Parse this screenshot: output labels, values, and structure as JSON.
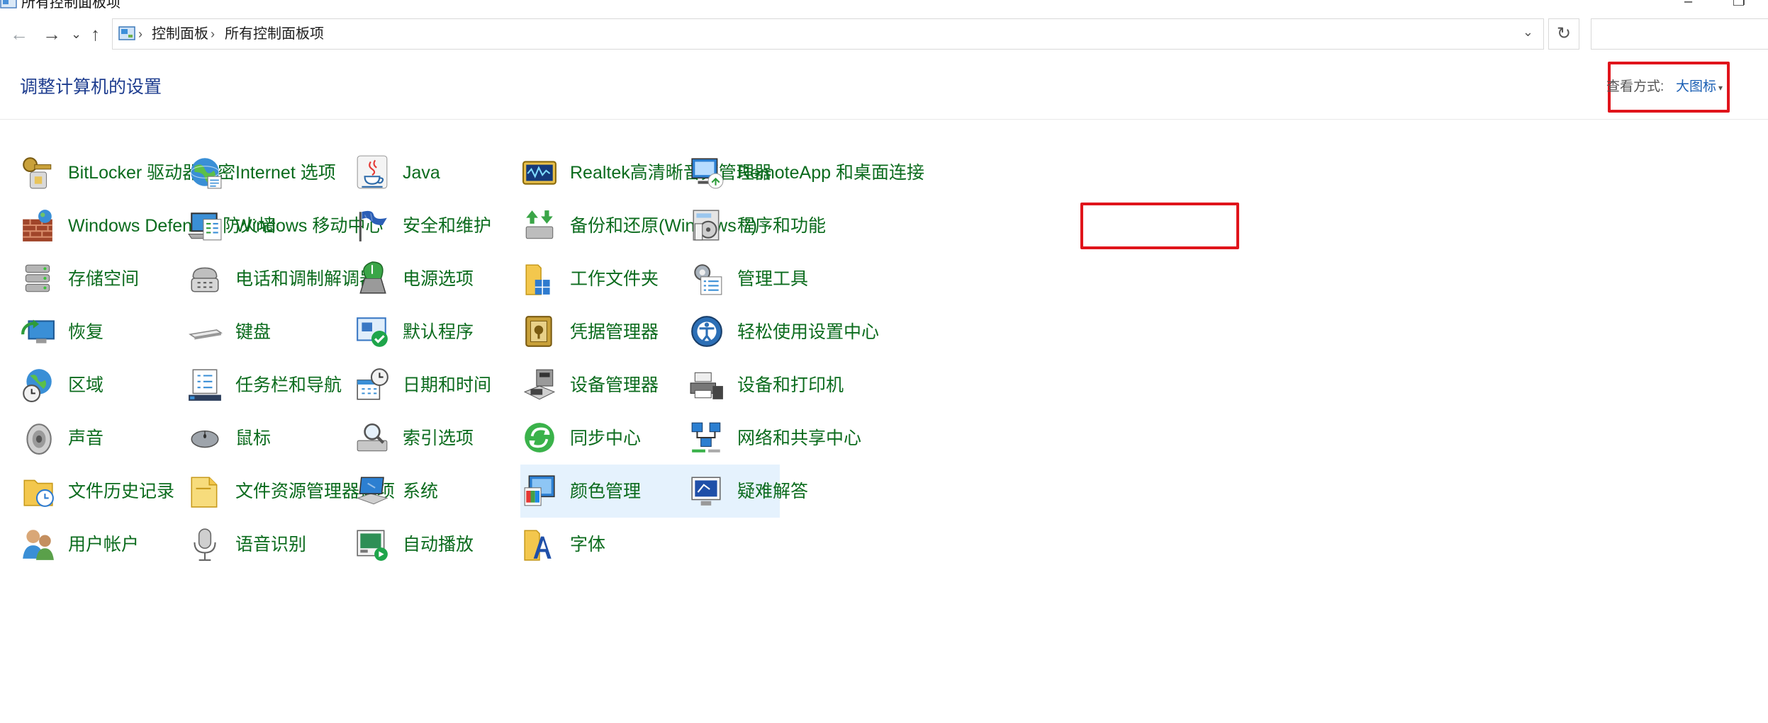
{
  "window": {
    "title": "所有控制面板项",
    "minimize_glyph": "–",
    "restore_glyph": "❐"
  },
  "nav": {
    "back_glyph": "←",
    "forward_glyph": "→",
    "recent_glyph": "⌄",
    "up_glyph": "↑",
    "breadcrumb": [
      "控制面板",
      "所有控制面板项"
    ],
    "breadcrumb_sep": "›",
    "dropdown_glyph": "⌄",
    "refresh_glyph": "↻",
    "search_placeholder": ""
  },
  "header": {
    "title": "调整计算机的设置",
    "view_label": "查看方式:",
    "view_value": "大图标",
    "view_caret": "▾"
  },
  "colors": {
    "item_text": "#0b6b1d",
    "title_text": "#1e3d8f",
    "highlight": "#e0141b",
    "selected_bg": "#e5f2fd"
  },
  "items": [
    [
      "BitLocker 驱动器加密",
      "Windows Defender 防火墙",
      "存储空间",
      "恢复",
      "区域",
      "声音",
      "文件历史记录",
      "用户帐户"
    ],
    [
      "Internet 选项",
      "Windows 移动中心",
      "电话和调制解调器",
      "键盘",
      "任务栏和导航",
      "鼠标",
      "文件资源管理器选项",
      "语音识别"
    ],
    [
      "Java",
      "安全和维护",
      "电源选项",
      "默认程序",
      "日期和时间",
      "索引选项",
      "系统",
      "自动播放"
    ],
    [
      "Realtek高清晰音频管理器",
      "备份和还原(Windows 7)",
      "工作文件夹",
      "凭据管理器",
      "设备管理器",
      "同步中心",
      "颜色管理",
      "字体"
    ],
    [
      "RemoteApp 和桌面连接",
      "程序和功能",
      "管理工具",
      "轻松使用设置中心",
      "设备和打印机",
      "网络和共享中心",
      "疑难解答"
    ]
  ],
  "icons": [
    [
      "bitlocker-icon",
      "firewall-icon",
      "storage-spaces-icon",
      "recovery-icon",
      "region-icon",
      "sound-icon",
      "file-history-icon",
      "user-accounts-icon"
    ],
    [
      "internet-options-icon",
      "mobility-center-icon",
      "phone-modem-icon",
      "keyboard-icon",
      "taskbar-icon",
      "mouse-icon",
      "explorer-options-icon",
      "speech-recognition-icon"
    ],
    [
      "java-icon",
      "security-maintenance-icon",
      "power-options-icon",
      "default-programs-icon",
      "date-time-icon",
      "indexing-options-icon",
      "system-icon",
      "autoplay-icon"
    ],
    [
      "realtek-audio-icon",
      "backup-restore-icon",
      "work-folders-icon",
      "credential-manager-icon",
      "device-manager-icon",
      "sync-center-icon",
      "color-management-icon",
      "fonts-icon"
    ],
    [
      "remoteapp-icon",
      "programs-features-icon",
      "admin-tools-icon",
      "ease-of-access-icon",
      "devices-printers-icon",
      "network-sharing-icon",
      "troubleshooting-icon"
    ]
  ],
  "selected_item": "颜色管理",
  "highlighted_item": "程序和功能"
}
